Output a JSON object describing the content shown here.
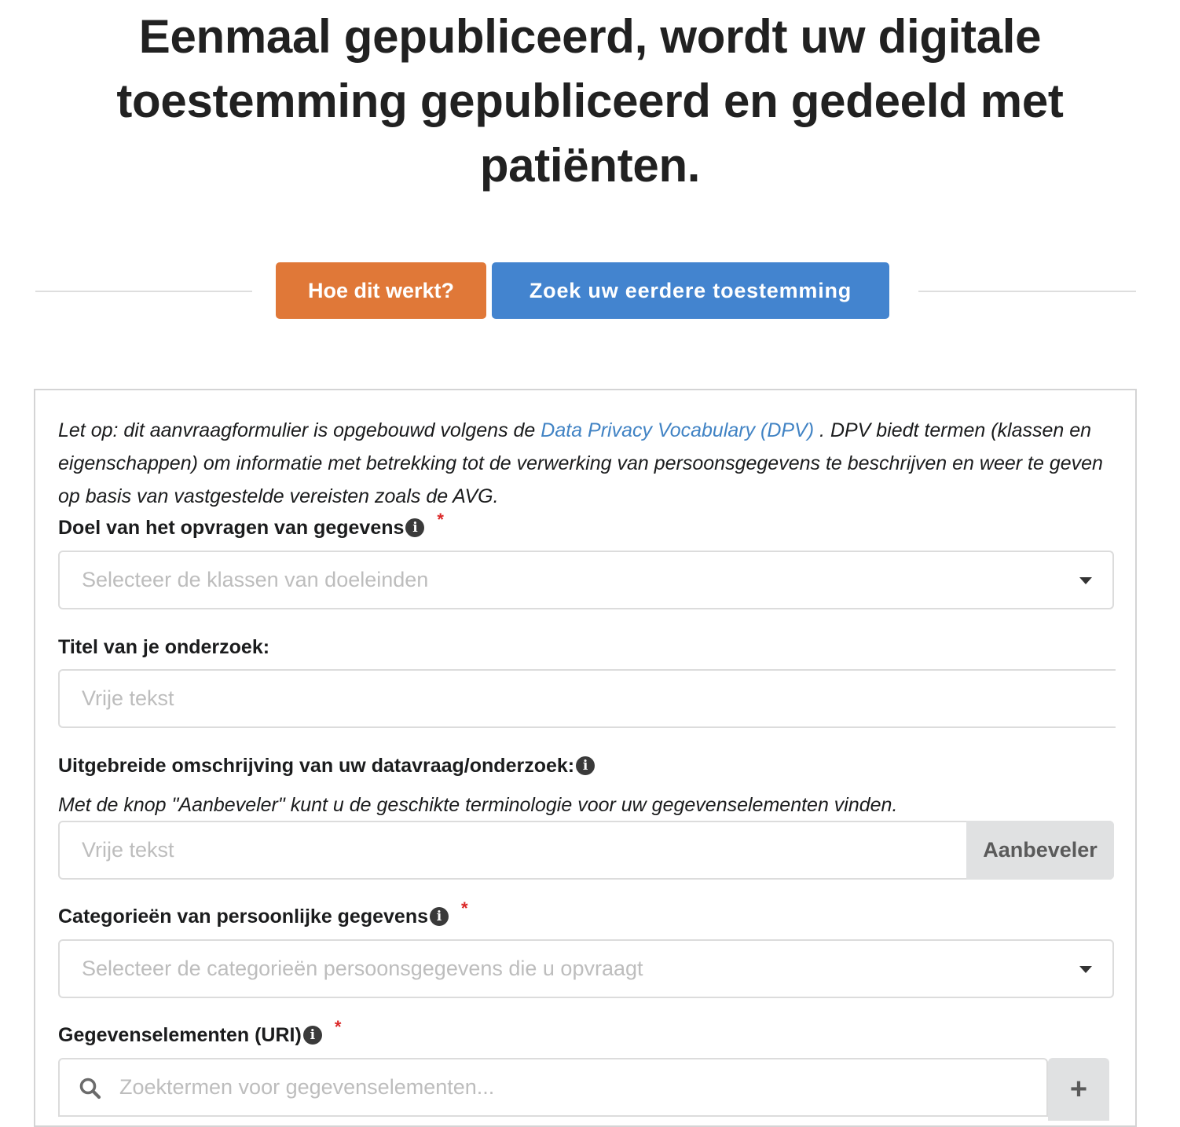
{
  "headline": {
    "line1": "Eenmaal gepubliceerd, wordt uw digitale",
    "line2": "toestemming gepubliceerd en gedeeld met",
    "line3": "patiënten."
  },
  "actions": {
    "how_it_works_label": "Hoe dit werkt?",
    "find_consent_label": "Zoek uw eerdere toestemming",
    "how_it_works_color": "#e07838",
    "find_consent_color": "#4384cf"
  },
  "notice": {
    "prefix": "Let op: dit aanvraagformulier is opgebouwd volgens de ",
    "link_text": "Data Privacy Vocabulary (DPV)",
    "suffix": " . DPV biedt termen (klassen en eigenschappen) om informatie met betrekking tot de verwerking van persoonsgegevens te beschrijven en weer te geven op basis van vastgestelde vereisten zoals de AVG."
  },
  "form": {
    "purpose": {
      "label": "Doel van het opvragen van gegevens",
      "required_mark": "*",
      "placeholder": "Selecteer de klassen van doeleinden"
    },
    "title": {
      "label": "Titel van je onderzoek:",
      "placeholder": "Vrije tekst"
    },
    "description": {
      "label": "Uitgebreide omschrijving van uw datavraag/onderzoek:",
      "helper": "Met de knop \"Aanbeveler\" kunt u de geschikte terminologie voor uw gegevenselementen vinden.",
      "placeholder": "Vrije tekst",
      "recommend_label": "Aanbeveler"
    },
    "categories": {
      "label": "Categorieën van persoonlijke gegevens",
      "required_mark": "*",
      "placeholder": "Selecteer de categorieën persoonsgegevens die u opvraagt"
    },
    "data_elements": {
      "label": "Gegevenselementen (URI)",
      "required_mark": "*",
      "placeholder": "Zoektermen voor gegevenselementen...",
      "add_label": "+"
    },
    "info_glyph": "i"
  }
}
